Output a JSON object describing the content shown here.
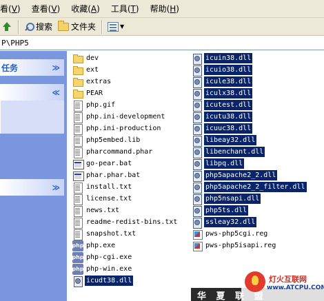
{
  "menu": [
    {
      "text": "看(V)",
      "label": "查看",
      "key": "V"
    },
    {
      "text": "收藏(A)",
      "label": "收藏",
      "key": "A"
    },
    {
      "text": "工具(T)",
      "label": "工具",
      "key": "T"
    },
    {
      "text": "帮助(H)",
      "label": "帮助",
      "key": "H"
    }
  ],
  "menu_first": {
    "prefix": "看",
    "key": "V"
  },
  "toolbar": {
    "up_icon": "folder-up-icon",
    "search_label": "搜索",
    "folders_label": "文件夹",
    "views_icon": "views-icon"
  },
  "address": {
    "path": "P\\PHP5"
  },
  "taskpane": {
    "header1": "任务",
    "header1_chevron": "≫",
    "header2_chevron": "≪",
    "header3_chevron": "≫"
  },
  "files_left": [
    {
      "name": "dev",
      "icon": "folder",
      "selected": false
    },
    {
      "name": "ext",
      "icon": "folder",
      "selected": false
    },
    {
      "name": "extras",
      "icon": "folder",
      "selected": false
    },
    {
      "name": "PEAR",
      "icon": "folder",
      "selected": false
    },
    {
      "name": "php.gif",
      "icon": "doc",
      "selected": false
    },
    {
      "name": "php.ini-development",
      "icon": "doc",
      "selected": false
    },
    {
      "name": "php.ini-production",
      "icon": "doc",
      "selected": false
    },
    {
      "name": "php5embed.lib",
      "icon": "doc",
      "selected": false
    },
    {
      "name": "pharcommand.phar",
      "icon": "doc",
      "selected": false
    },
    {
      "name": "go-pear.bat",
      "icon": "bat",
      "selected": false
    },
    {
      "name": "phar.phar.bat",
      "icon": "bat",
      "selected": false
    },
    {
      "name": "install.txt",
      "icon": "doc",
      "selected": false
    },
    {
      "name": "license.txt",
      "icon": "doc",
      "selected": false
    },
    {
      "name": "news.txt",
      "icon": "doc",
      "selected": false
    },
    {
      "name": "readme-redist-bins.txt",
      "icon": "doc",
      "selected": false
    },
    {
      "name": "snapshot.txt",
      "icon": "doc",
      "selected": false
    },
    {
      "name": "php.exe",
      "icon": "exe",
      "selected": false
    },
    {
      "name": "php-cgi.exe",
      "icon": "exe",
      "selected": false
    },
    {
      "name": "php-win.exe",
      "icon": "exe",
      "selected": false
    },
    {
      "name": "icudt38.dll",
      "icon": "dll",
      "selected": true
    }
  ],
  "files_right": [
    {
      "name": "icuin38.dll",
      "icon": "dll",
      "selected": true
    },
    {
      "name": "icuio38.dll",
      "icon": "dll",
      "selected": true
    },
    {
      "name": "icule38.dll",
      "icon": "dll",
      "selected": true
    },
    {
      "name": "iculx38.dll",
      "icon": "dll",
      "selected": true
    },
    {
      "name": "icutest.dll",
      "icon": "dll",
      "selected": true
    },
    {
      "name": "icutu38.dll",
      "icon": "dll",
      "selected": true
    },
    {
      "name": "icuuc38.dll",
      "icon": "dll",
      "selected": true
    },
    {
      "name": "libeay32.dll",
      "icon": "dll",
      "selected": true
    },
    {
      "name": "libenchant.dll",
      "icon": "dll",
      "selected": true
    },
    {
      "name": "libpq.dll",
      "icon": "dll",
      "selected": true
    },
    {
      "name": "php5apache2_2.dll",
      "icon": "dll",
      "selected": true
    },
    {
      "name": "php5apache2_2_filter.dll",
      "icon": "dll",
      "selected": true
    },
    {
      "name": "php5nsapi.dll",
      "icon": "dll",
      "selected": true
    },
    {
      "name": "php5ts.dll",
      "icon": "dll",
      "selected": true
    },
    {
      "name": "ssleay32.dll",
      "icon": "dll",
      "selected": true
    },
    {
      "name": "pws-php5cgi.reg",
      "icon": "reg",
      "selected": false
    },
    {
      "name": "pws-php5isapi.reg",
      "icon": "reg",
      "selected": false
    }
  ],
  "watermark": {
    "text": "华 夏 联 盟",
    "cn": "灯火互联网",
    "url": "www.ATCPU.COM"
  },
  "colors": {
    "selection": "#0a246a",
    "taskpane": "#7a96df",
    "chrome": "#ece9d8"
  }
}
